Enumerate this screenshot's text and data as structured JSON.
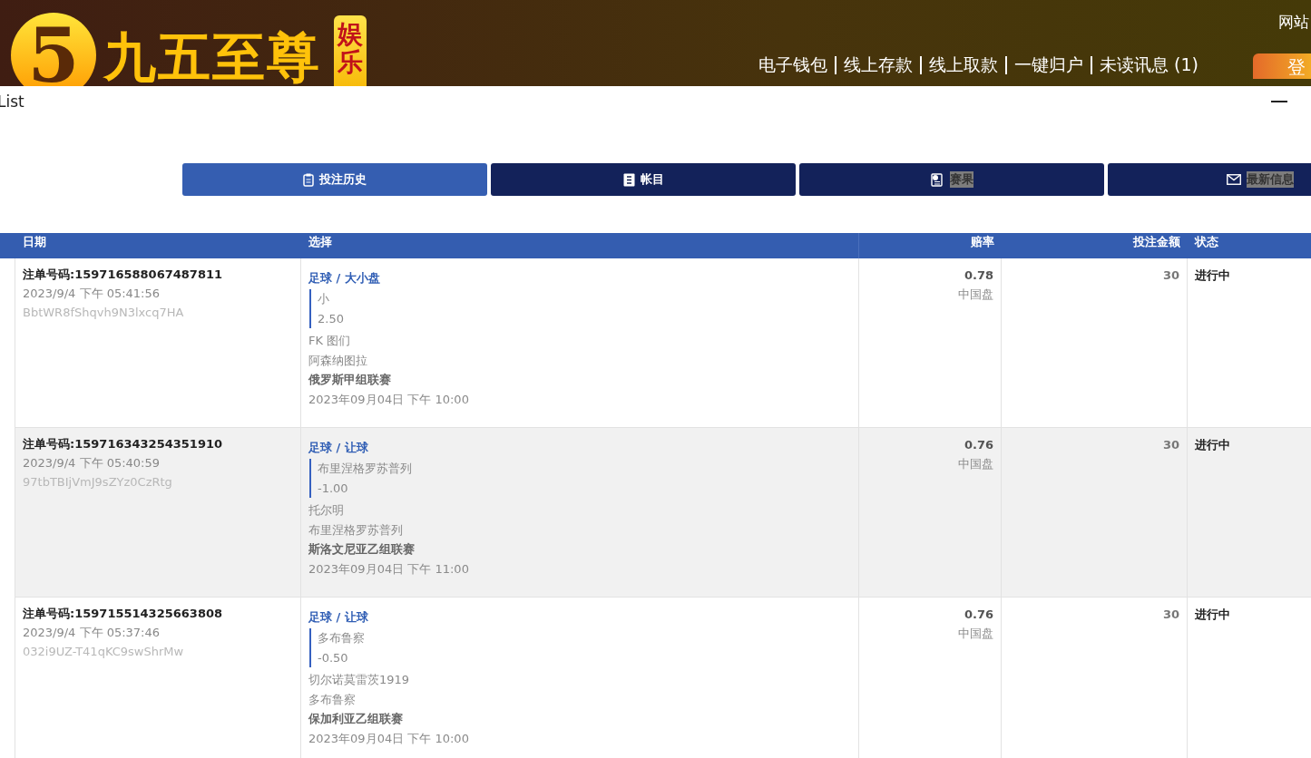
{
  "header": {
    "logo_mark": "5",
    "brand": "九五至尊",
    "brand_badge": "娱乐",
    "top_link": "网站",
    "nav": [
      "电子钱包",
      "线上存款",
      "线上取款",
      "一键归户",
      "未读讯息 (1)"
    ],
    "login_button": "登"
  },
  "panel": {
    "title": "List"
  },
  "tabs": [
    {
      "label": "投注历史",
      "kind": "clipboard",
      "selected": true,
      "text_highlighted": false
    },
    {
      "label": "帐目",
      "kind": "ledger",
      "selected": false,
      "text_highlighted": false
    },
    {
      "label": "赛果",
      "kind": "results",
      "selected": false,
      "text_highlighted": true
    },
    {
      "label": "最新信息",
      "kind": "mail",
      "selected": false,
      "text_highlighted": true
    }
  ],
  "table": {
    "columns": [
      "日期",
      "选择",
      "赔率",
      "投注金额",
      "状态"
    ],
    "rows": [
      {
        "order": "注单号码:159716588067487811",
        "time": "2023/9/4 下午 05:41:56",
        "code": "BbtWR8fShqvh9N3lxcq7HA",
        "market": "足球 / 大小盘",
        "pick": "小",
        "line": "2.50",
        "home": "FK 图们",
        "away": "阿森纳图拉",
        "league": "俄罗斯甲组联赛",
        "kickoff": "2023年09月04日 下午 10:00",
        "odds": "0.78",
        "odds_type": "中国盘",
        "stake": "30",
        "status": "进行中",
        "selected": false
      },
      {
        "order": "注单号码:159716343254351910",
        "time": "2023/9/4 下午 05:40:59",
        "code": "97tbTBIjVmJ9sZYz0CzRtg",
        "market": "足球 / 让球",
        "pick": "布里涅格罗苏普列",
        "line": "-1.00",
        "home": "托尔明",
        "away": "布里涅格罗苏普列",
        "league": "斯洛文尼亚乙组联赛",
        "kickoff": "2023年09月04日 下午 11:00",
        "odds": "0.76",
        "odds_type": "中国盘",
        "stake": "30",
        "status": "进行中",
        "selected": true
      },
      {
        "order": "注单号码:159715514325663808",
        "time": "2023/9/4 下午 05:37:46",
        "code": "032i9UZ-T41qKC9swShrMw",
        "market": "足球 / 让球",
        "pick": "多布鲁察",
        "line": "-0.50",
        "home": "切尔诺莫雷茨1919",
        "away": "多布鲁察",
        "league": "保加利亚乙组联赛",
        "kickoff": "2023年09月04日 下午 10:00",
        "odds": "0.76",
        "odds_type": "中国盘",
        "stake": "30",
        "status": "进行中",
        "selected": false
      }
    ]
  }
}
